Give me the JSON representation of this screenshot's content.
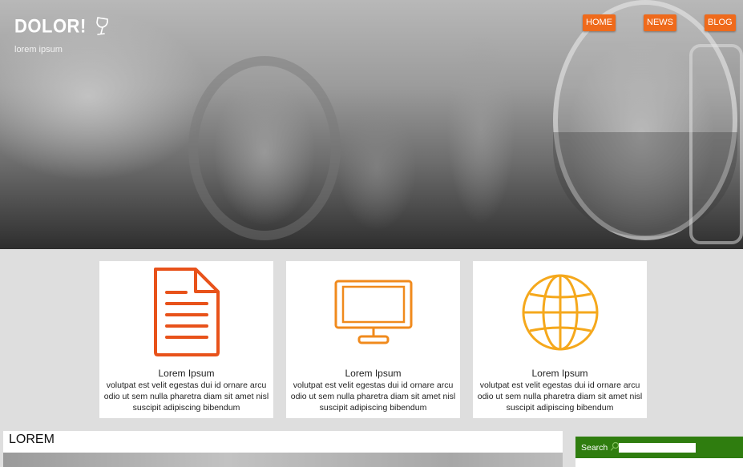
{
  "header": {
    "logo_text": "DOLOR!",
    "logo_icon": "wine-glass-icon",
    "tagline": "lorem ipsum"
  },
  "nav": {
    "items": [
      {
        "label": "HOME"
      },
      {
        "label": "NEWS"
      },
      {
        "label": "BLOG"
      }
    ],
    "accent_color": "#ef6a1b"
  },
  "features": [
    {
      "icon": "document-icon",
      "icon_color": "#e8521a",
      "title": "Lorem Ipsum",
      "body": "volutpat est velit egestas dui id ornare arcu odio ut sem nulla pharetra diam sit amet nisl suscipit adipiscing bibendum"
    },
    {
      "icon": "monitor-icon",
      "icon_color": "#f08a1c",
      "title": "Lorem Ipsum",
      "body": "volutpat est velit egestas dui id ornare arcu odio ut sem nulla pharetra diam sit amet nisl suscipit adipiscing bibendum"
    },
    {
      "icon": "globe-icon",
      "icon_color": "#f5a81c",
      "title": "Lorem Ipsum",
      "body": "volutpat est velit egestas dui id ornare arcu odio ut sem nulla pharetra diam sit amet nisl suscipit adipiscing bibendum"
    }
  ],
  "main": {
    "heading": "LOREM"
  },
  "sidebar": {
    "search_label": "Search",
    "search_value": "",
    "search_bg_color": "#2f7d0f"
  }
}
